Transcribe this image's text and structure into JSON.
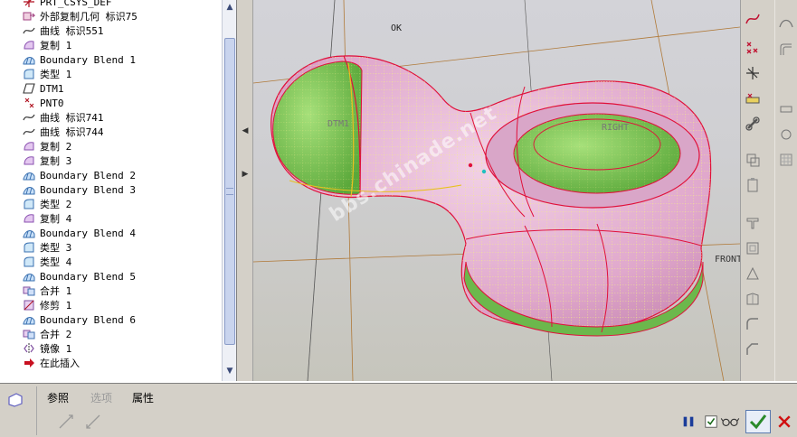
{
  "tree": {
    "items": [
      {
        "label": "PRT_CSYS_DEF",
        "icon": "csys-icon"
      },
      {
        "label": "外部复制几何 标识75",
        "icon": "external-copy-geom-icon"
      },
      {
        "label": "曲线 标识551",
        "icon": "curve-icon"
      },
      {
        "label": "复制 1",
        "icon": "copy-surface-icon"
      },
      {
        "label": "Boundary Blend 1",
        "icon": "boundary-blend-icon"
      },
      {
        "label": "类型 1",
        "icon": "type-icon"
      },
      {
        "label": "DTM1",
        "icon": "datum-plane-icon"
      },
      {
        "label": "PNT0",
        "icon": "datum-point-icon"
      },
      {
        "label": "曲线 标识741",
        "icon": "curve-icon"
      },
      {
        "label": "曲线 标识744",
        "icon": "curve-icon"
      },
      {
        "label": "复制 2",
        "icon": "copy-surface-icon"
      },
      {
        "label": "复制 3",
        "icon": "copy-surface-icon"
      },
      {
        "label": "Boundary Blend 2",
        "icon": "boundary-blend-icon"
      },
      {
        "label": "Boundary Blend 3",
        "icon": "boundary-blend-icon"
      },
      {
        "label": "类型 2",
        "icon": "type-icon"
      },
      {
        "label": "复制 4",
        "icon": "copy-surface-icon"
      },
      {
        "label": "Boundary Blend 4",
        "icon": "boundary-blend-icon"
      },
      {
        "label": "类型 3",
        "icon": "type-icon"
      },
      {
        "label": "类型 4",
        "icon": "type-icon"
      },
      {
        "label": "Boundary Blend 5",
        "icon": "boundary-blend-icon"
      },
      {
        "label": "合并 1",
        "icon": "merge-icon"
      },
      {
        "label": "修剪 1",
        "icon": "trim-icon"
      },
      {
        "label": "Boundary Blend 6",
        "icon": "boundary-blend-icon"
      },
      {
        "label": "合并 2",
        "icon": "merge-icon"
      },
      {
        "label": "镜像 1",
        "icon": "mirror-icon"
      },
      {
        "label": "在此插入",
        "icon": "insert-here-icon"
      }
    ]
  },
  "viewport": {
    "labels": {
      "ok": "OK",
      "dtm1": "DTM1",
      "right": "RIGHT",
      "front": "FRONT",
      "watermark": "bbs.chinade.net"
    },
    "colors": {
      "surface_pink": "#e8b6d6",
      "surface_green": "#7fc85a",
      "edge_red": "#e0103a",
      "mesh_yellow": "#f0e070",
      "datum_brown": "#b07a3a"
    }
  },
  "dashboard": {
    "tabs": [
      "参照",
      "选项",
      "属性"
    ],
    "disabled_tab_index": 1,
    "colors": {
      "pause_blue": "#1a3c9a",
      "ok_green": "#2a8a2a",
      "cancel_red": "#d01010"
    }
  }
}
